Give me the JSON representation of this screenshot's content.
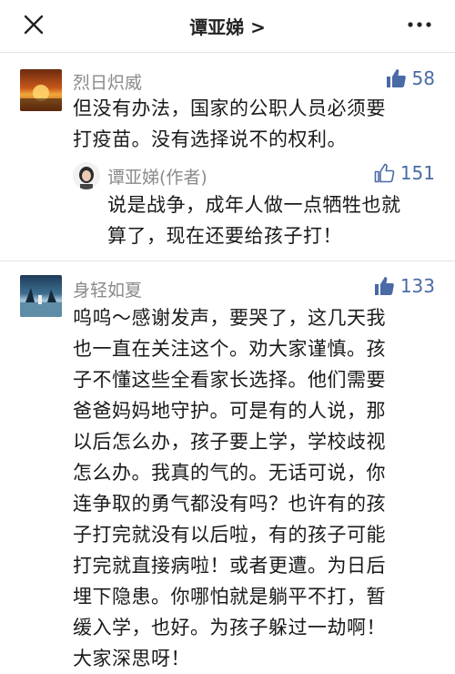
{
  "header": {
    "title": "谭亚娣 >"
  },
  "comments": [
    {
      "username": "烈日炽威",
      "likes": "58",
      "lines": [
        "但没有办法，国家的公职人员必须要",
        "打疫苗。没有选择说不的权利。"
      ],
      "reply": {
        "username": "谭亚娣(作者)",
        "likes": "151",
        "lines": [
          "说是战争，成年人做一点牺牲也就",
          "算了，现在还要给孩子打！"
        ]
      }
    },
    {
      "username": "身轻如夏",
      "likes": "133",
      "lines": [
        "呜呜～感谢发声，要哭了，这几天我",
        "也一直在关注这个。劝大家谨慎。孩",
        "子不懂这些全看家长选择。他们需要",
        "爸爸妈妈地守护。可是有的人说，那",
        "以后怎么办，孩子要上学，学校歧视",
        "怎么办。我真的气的。无话可说，你",
        "连争取的勇气都没有吗？也许有的孩",
        "子打完就没有以后啦，有的孩子可能",
        "打完就直接病啦！或者更遭。为日后",
        "埋下隐患。你哪怕就是躺平不打，暂",
        "缓入学，也好。为孩子躲过一劫啊！",
        "大家深思呀！"
      ]
    }
  ],
  "colors": {
    "like_filled": "#4a6aa5",
    "like_outline": "#4a6aa5",
    "username": "#8a8a8a"
  }
}
